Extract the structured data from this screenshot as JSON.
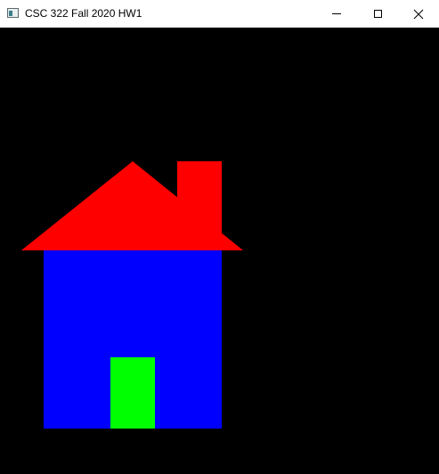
{
  "window": {
    "title": "CSC 322 Fall 2020 HW1",
    "app_icon": "window-app-icon",
    "controls": {
      "minimize_icon": "minimize-icon",
      "maximize_icon": "maximize-icon",
      "close_icon": "close-icon"
    }
  },
  "canvas": {
    "background_color": "#000000",
    "shapes": [
      {
        "name": "house-body",
        "type": "rectangle",
        "color": "#0000ff"
      },
      {
        "name": "roof",
        "type": "triangle",
        "color": "#ff0000"
      },
      {
        "name": "chimney",
        "type": "rectangle",
        "color": "#ff0000"
      },
      {
        "name": "door",
        "type": "rectangle",
        "color": "#00ff00"
      }
    ]
  }
}
